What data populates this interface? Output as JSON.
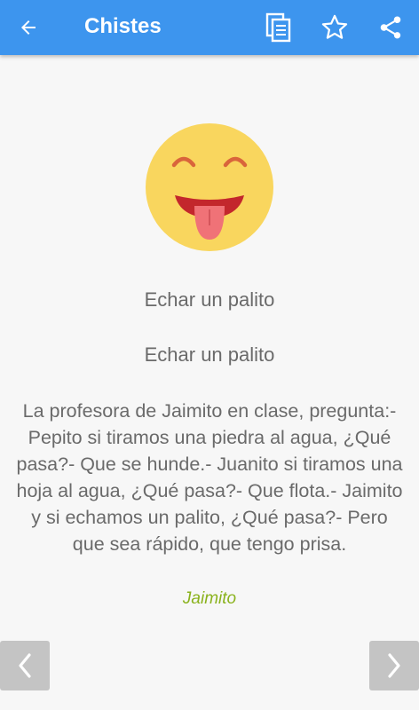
{
  "appbar": {
    "title": "Chistes",
    "back_icon": "arrow-left-icon",
    "actions": [
      {
        "name": "copy",
        "icon": "copy-icon"
      },
      {
        "name": "favorite",
        "icon": "star-icon"
      },
      {
        "name": "share",
        "icon": "share-icon"
      }
    ]
  },
  "joke": {
    "emoji": "tongue-out-emoji-icon",
    "title": "Echar un palito",
    "subtitle": "Echar un palito",
    "text": "La profesora de Jaimito en clase, pregunta:- Pepito si tiramos una piedra al agua, ¿Qué pasa?- Que se hunde.- Juanito si tiramos una hoja al agua, ¿Qué pasa?- Que flota.- Jaimito y si echamos un palito, ¿Qué pasa?- Pero que sea rápido, que tengo prisa.",
    "category": "Jaimito"
  },
  "navigation": {
    "prev_icon": "chevron-left-icon",
    "next_icon": "chevron-right-icon"
  },
  "colors": {
    "appbar": "#3d95ee",
    "background": "#f7f7f7",
    "text": "#6a6a6a",
    "category": "#8ab21c",
    "nav_button": "#c4c4c4",
    "emoji_face": "#f9d65e"
  }
}
